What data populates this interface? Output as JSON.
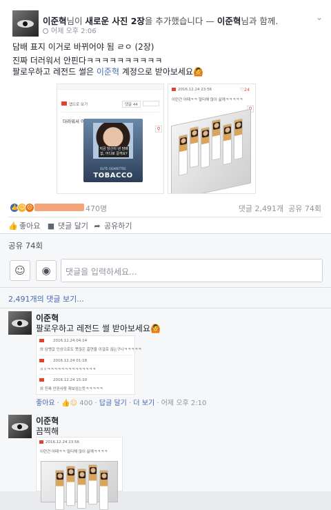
{
  "post": {
    "author": "이준혁",
    "action_text": "님이",
    "action_bold": "새로운 사진 2장",
    "action_tail": "을 추가했습니다 —",
    "with_name": "이준혁",
    "with_tail": "님과 함께.",
    "time": "어제 오후 2:06",
    "lines": [
      "담배 표지 이거로 바뀌어야 됨 ㄹㅇ (2장)",
      "진짜 더러워서 안핀다ㅋㅋㅋㅋㅋㅋㅋㅋㅋㅋ"
    ],
    "line3_pre": "팔로우하고 레전드 썰은",
    "line3_mention": "이준혁",
    "line3_post": "계정으로 받아보세요🙆"
  },
  "photo1": {
    "top_label": "앱으로 보기",
    "pill1": "댓글 44",
    "pill2": "",
    "title": "더러워서 이제도 안삽도",
    "warning": "지금 당신이 낸 담배값, 어디로 갈까요?",
    "pack_small": "ELITE CIGARETTES",
    "pack_brand": "TOBACCO"
  },
  "photo2": {
    "date": "2016.12.24 23:56",
    "count": "24",
    "text": "이런건 어때ㅋㅋ 멀티해 많이 삶께ㅋㅋㅋㅋㅋ"
  },
  "reactions": {
    "count": "470명",
    "comments": "댓글 2,491개",
    "shares": "공유 74회"
  },
  "actions": {
    "like": "좋아요",
    "comment": "댓글 달기",
    "share": "공유하기"
  },
  "share_label": "공유 74회",
  "comment_input": {
    "placeholder": "댓글을 입력하세요..."
  },
  "more_comments": "2,491개의 댓글 보기...",
  "comment1": {
    "name": "이준혁",
    "text": "팔로우하고 레전드 썰 받아보세요🙆",
    "rows": [
      {
        "date": "2016.12.24 04:14",
        "text": "와 담뱃값 인상으로도 못끊은 흡연율 이걸로 끊는구나ㅋㅋㅋㅋㅋ"
      },
      {
        "date": "2016.12.24 01:18",
        "text": "ㅇㅈㅋㅋㅋㅋㅋㅋㅋㅋㅋㅋㅋㅋㅋㅋ"
      },
      {
        "date": "2016.12.24 15:10",
        "text": "와 진짜 안핀사람 재보임는듯ㅋㅋㅋㅋㅋ"
      }
    ],
    "like": "좋아요",
    "like_count": "400",
    "reply": "답글 달기",
    "more": "더 보기",
    "time": "어제 오후 2:10"
  },
  "comment2": {
    "name": "이준혁",
    "text": "끔찍해",
    "shot_date": "2016.12.24 23:56",
    "shot_text": "이런건 어때ㅋㅋ 멀티해 많이 삶께ㅋㅋㅋㅋ"
  },
  "colors": {
    "link": "#4267b2",
    "accent_red": "#e4412f",
    "bg": "#e9ebee"
  },
  "icons": [
    "globe-icon",
    "chevron-down-icon",
    "like-reaction-icon",
    "haha-reaction-icon",
    "angry-reaction-icon",
    "thumbs-up-icon",
    "comment-icon",
    "share-arrow-icon",
    "emoji-icon",
    "camera-icon",
    "magnifier-icon"
  ]
}
